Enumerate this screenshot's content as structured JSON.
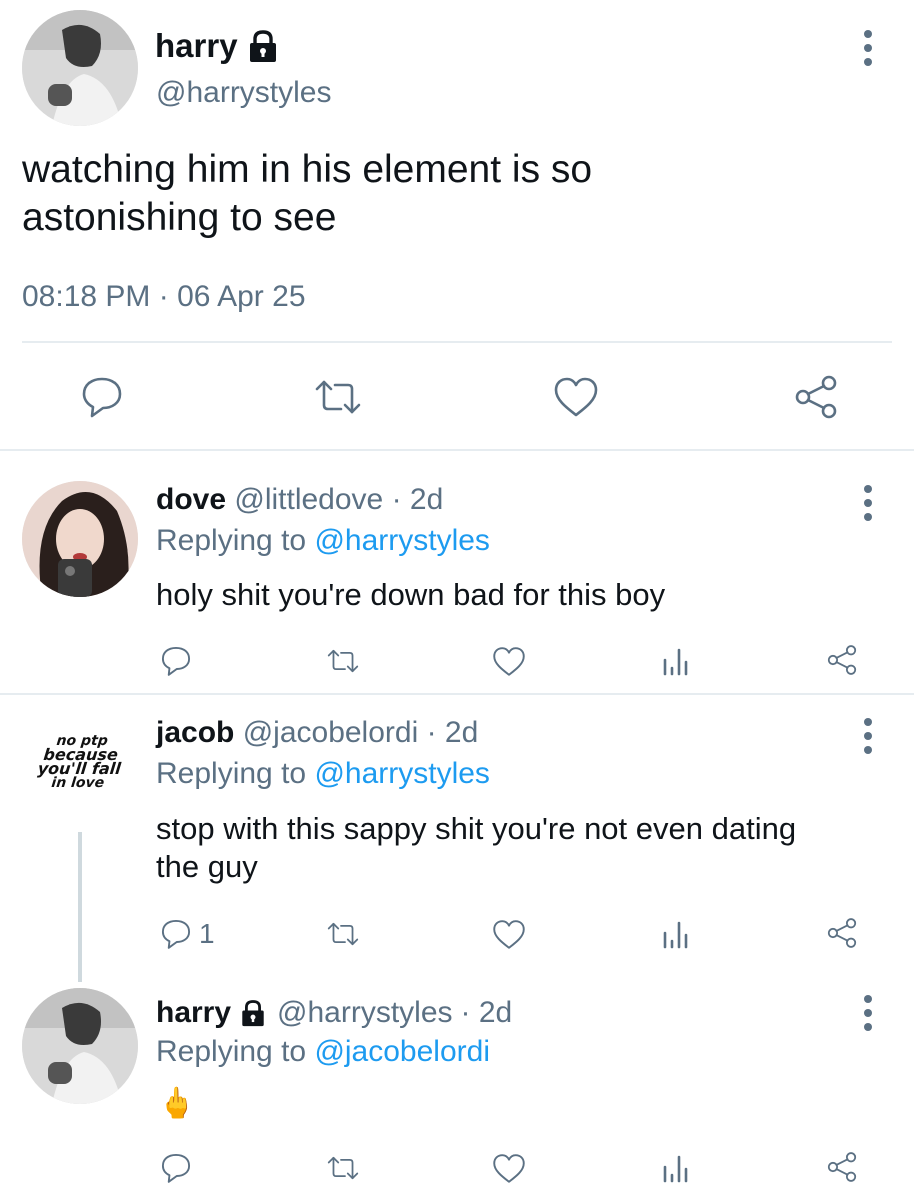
{
  "main_tweet": {
    "name": "harry",
    "handle": "@harrystyles",
    "text_line1": "watching him in his element is so",
    "text_line2": "astonishing to see",
    "timestamp": "08:18 PM · 06 Apr 25",
    "protected_icon": "lock-icon",
    "actions": [
      "reply-icon",
      "retweet-icon",
      "like-icon",
      "share-icon"
    ]
  },
  "replies": [
    {
      "name": "dove",
      "handle": "@littledove",
      "age": "· 2d",
      "replying_prefix": "Replying to",
      "replying_to": "@harrystyles",
      "text_line1": "holy shit you're down bad for this boy",
      "text_line2": "",
      "reply_count": ""
    },
    {
      "name": "jacob",
      "handle": "@jacobelordi",
      "age": "· 2d",
      "replying_prefix": "Replying to",
      "replying_to": "@harrystyles",
      "text_line1": "stop with this sappy shit you're not even dating",
      "text_line2": "the guy",
      "reply_count": "1",
      "avatar_text": [
        "no ptp",
        "because",
        "you'll fall",
        "in love"
      ]
    },
    {
      "name": "harry",
      "handle": "@harrystyles",
      "age": "· 2d",
      "replying_prefix": "Replying to",
      "replying_to": "@jacobelordi",
      "text_line1": "🖕",
      "text_line2": "",
      "reply_count": ""
    }
  ],
  "colors": {
    "link": "#1d9bf0",
    "secondary": "#5b7083",
    "divider": "#e6ecf0"
  }
}
